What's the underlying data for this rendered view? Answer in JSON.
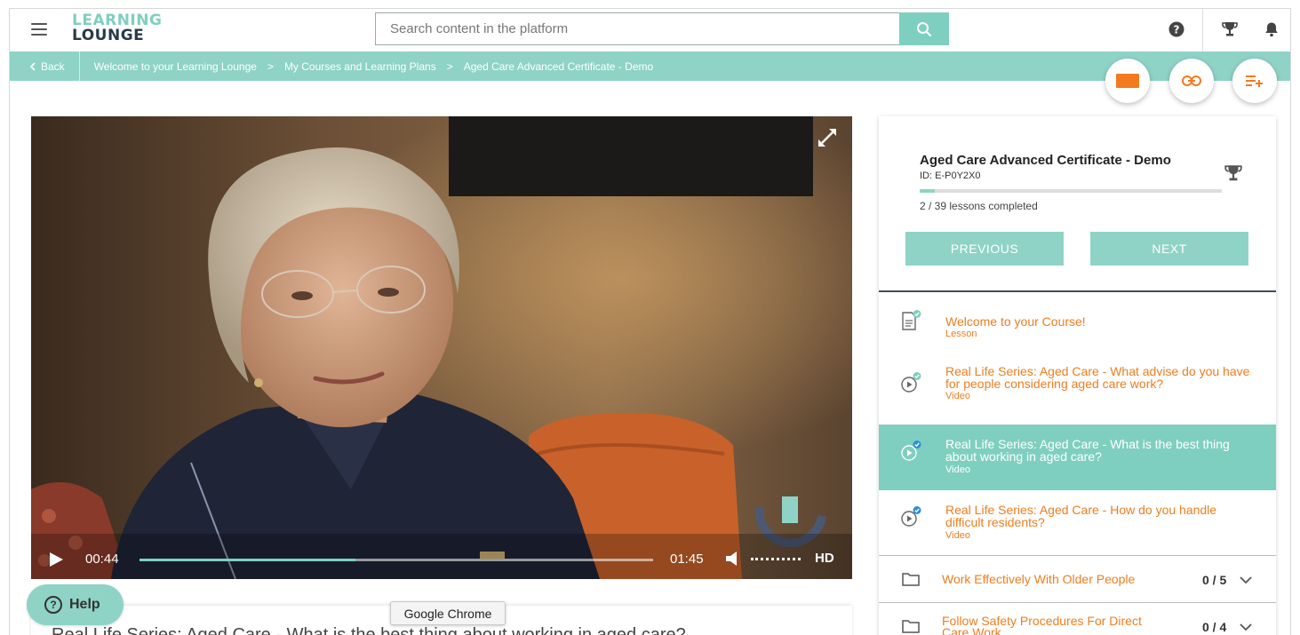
{
  "header": {
    "logo_line1": "LEARNING",
    "logo_line2": "LOUNGE",
    "search_placeholder": "Search content in the platform",
    "icons": [
      "menu-icon",
      "search-icon",
      "help-icon",
      "trophy-icon",
      "bell-icon"
    ]
  },
  "breadcrumb": {
    "back_label": "Back",
    "items": [
      "Welcome to your Learning Lounge",
      "My Courses and Learning Plans",
      "Aged Care Advanced Certificate - Demo"
    ],
    "separator": ">"
  },
  "video": {
    "current_time": "00:44",
    "duration": "01:45",
    "progress": 0.42,
    "quality": "HD"
  },
  "below_video": {
    "title": "Real Life Series: Aged Care - What is the best thing about working in aged care?"
  },
  "tooltip": "Google Chrome",
  "help_label": "Help",
  "course": {
    "title": "Aged Care Advanced Certificate - Demo",
    "id": "ID: E-P0Y2X0",
    "progress_text": "2 / 39 lessons completed",
    "progress_fraction": 0.051,
    "previous_label": "PREVIOUS",
    "next_label": "NEXT",
    "items": [
      {
        "title": "Welcome to your Course!",
        "type": "Lesson",
        "icon": "document-icon",
        "status": "completed"
      },
      {
        "title": "Real Life Series: Aged Care - What advise do you have for people considering aged care work?",
        "type": "Video",
        "icon": "play-circle-icon",
        "status": "completed"
      },
      {
        "title": "Real Life Series: Aged Care - What is the best thing about working in aged care?",
        "type": "Video",
        "icon": "play-circle-icon",
        "status": "current"
      },
      {
        "title": "Real Life Series: Aged Care - How do you handle difficult residents?",
        "type": "Video",
        "icon": "play-circle-icon",
        "status": "current"
      }
    ],
    "sections": [
      {
        "title": "Work Effectively With Older People",
        "count": "0 / 5"
      },
      {
        "title": "Follow Safety Procedures For Direct Care Work",
        "count": "0 / 4"
      }
    ]
  },
  "colors": {
    "accent": "#8fd3c6",
    "accent_dark": "#7fcfc0",
    "orange": "#f07d1e",
    "check_blue": "#2a8fd6"
  }
}
